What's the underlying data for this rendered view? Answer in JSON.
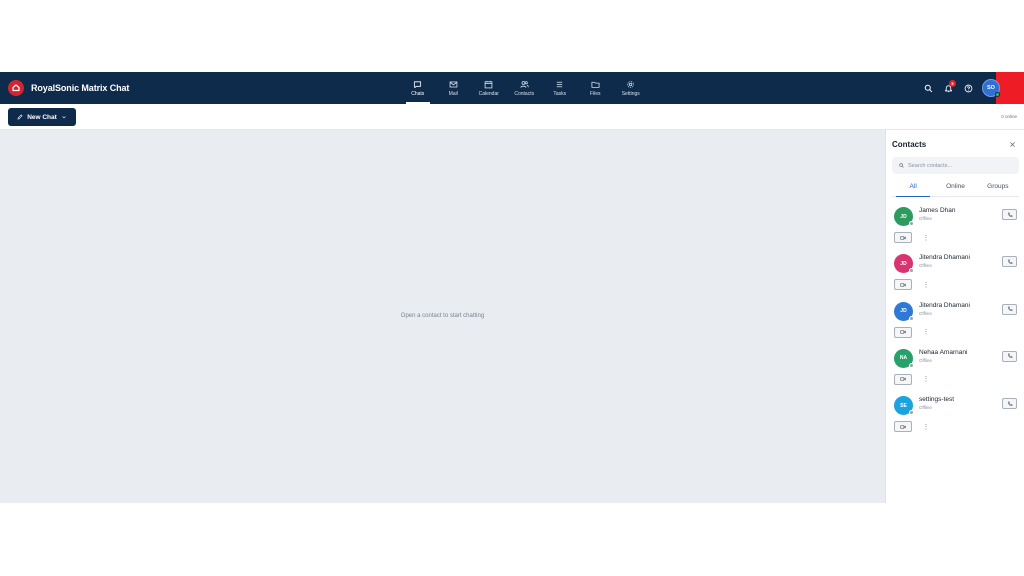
{
  "app": {
    "title": "RoyalSonic Matrix Chat"
  },
  "nav": [
    {
      "label": "Chats",
      "icon": "chat-icon",
      "active": true
    },
    {
      "label": "Mail",
      "icon": "mail-icon"
    },
    {
      "label": "Calendar",
      "icon": "calendar-icon"
    },
    {
      "label": "Contacts",
      "icon": "contacts-icon"
    },
    {
      "label": "Tasks",
      "icon": "tasks-icon"
    },
    {
      "label": "Files",
      "icon": "folder-icon"
    },
    {
      "label": "Settings",
      "icon": "gear-icon"
    }
  ],
  "header": {
    "notification_count": "5",
    "user_initials": "SO"
  },
  "toolbar": {
    "new_chat_label": "New Chat",
    "online_count": "0 online"
  },
  "main": {
    "empty_message": "Open a contact to start chatting"
  },
  "contacts_panel": {
    "title": "Contacts",
    "search_placeholder": "Search contacts...",
    "tabs": [
      "All",
      "Online",
      "Groups"
    ],
    "active_tab": "All",
    "contacts": [
      {
        "initials": "JD",
        "name": "James Dhan",
        "status": "Offline",
        "color": "#2e9b5e"
      },
      {
        "initials": "JD",
        "name": "Jitendra Dhamani",
        "status": "Offline",
        "color": "#d8346f"
      },
      {
        "initials": "JD",
        "name": "Jitendra Dhamani",
        "status": "Offline",
        "color": "#2f79d6"
      },
      {
        "initials": "NA",
        "name": "Nehaa Amarnani",
        "status": "Offline",
        "color": "#27a06a"
      },
      {
        "initials": "SE",
        "name": "settings-test",
        "status": "Offline",
        "color": "#1aa3e0"
      }
    ]
  },
  "colors": {
    "topbar": "#0f2b4c",
    "brand_red": "#d3252f",
    "accent_blue": "#1f63c6",
    "main_bg": "#e9edf1"
  }
}
